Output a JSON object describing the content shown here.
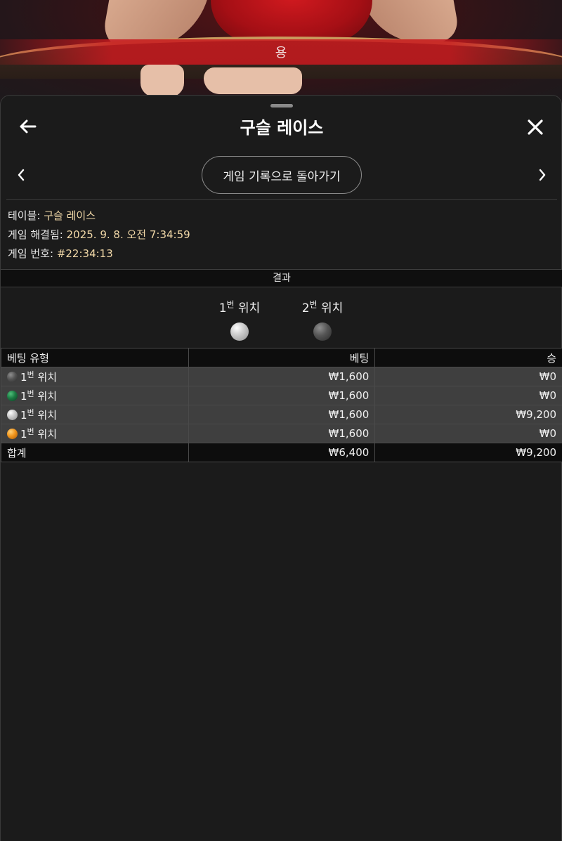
{
  "video": {
    "banner_text": "용"
  },
  "header": {
    "title": "구슬 레이스"
  },
  "nav": {
    "history_button": "게임 기록으로 돌아가기"
  },
  "info": {
    "table_label": "테이블:",
    "table_value": "구슬 레이스",
    "resolved_label": "게임 해결됨:",
    "resolved_value": "2025. 9. 8. 오전 7:34:59",
    "game_no_label": "게임 번호:",
    "game_no_value": "#22:34:13"
  },
  "result": {
    "label": "결과",
    "positions": [
      {
        "num": "1",
        "sup": "번",
        "label": "위치",
        "ball": "silver"
      },
      {
        "num": "2",
        "sup": "번",
        "label": "위치",
        "ball": "dark-gray"
      }
    ]
  },
  "bets_table": {
    "headers": {
      "type": "베팅 유형",
      "bet": "베팅",
      "win": "승"
    },
    "rows": [
      {
        "ball": "dark-gray",
        "num": "1",
        "sup": "번",
        "label": "위치",
        "bet": "₩1,600",
        "win": "₩0"
      },
      {
        "ball": "green",
        "num": "1",
        "sup": "번",
        "label": "위치",
        "bet": "₩1,600",
        "win": "₩0"
      },
      {
        "ball": "silver",
        "num": "1",
        "sup": "번",
        "label": "위치",
        "bet": "₩1,600",
        "win": "₩9,200"
      },
      {
        "ball": "orange",
        "num": "1",
        "sup": "번",
        "label": "위치",
        "bet": "₩1,600",
        "win": "₩0"
      }
    ],
    "total": {
      "label": "합계",
      "bet": "₩6,400",
      "win": "₩9,200"
    }
  },
  "colors": {
    "background": "#1b1b1b",
    "info_value": "#f2d9a8",
    "row_bg": "#3f3f3f",
    "header_bg": "#0d0d0d"
  }
}
